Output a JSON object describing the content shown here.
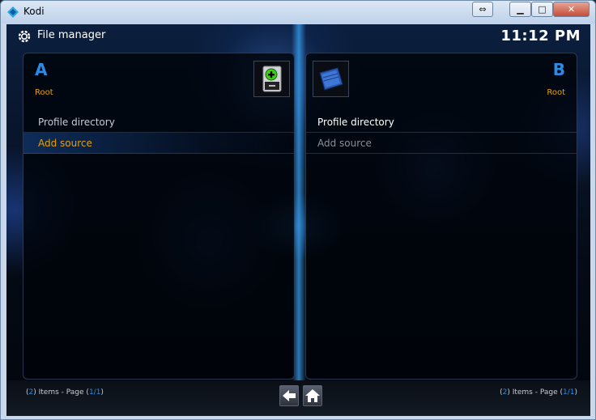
{
  "window": {
    "title": "Kodi",
    "controls": {
      "restore": "⇔",
      "minimize": "▁",
      "maximize": "□",
      "close": "✕"
    }
  },
  "header": {
    "title": "File manager",
    "clock": "11:12 PM",
    "icon": "gear-icon"
  },
  "panels": [
    {
      "letter": "A",
      "path": "Root",
      "thumb_icon": "add-drive-icon",
      "items": [
        {
          "label": "Profile directory",
          "color": "#c8ccd2"
        },
        {
          "label": "Add source",
          "color": "#e8a000",
          "selected": true
        }
      ],
      "footer": {
        "count": "2",
        "items_text": " Items - Page ",
        "page": "1/1"
      }
    },
    {
      "letter": "B",
      "path": "Root",
      "thumb_icon": "folder-icon",
      "items": [
        {
          "label": "Profile directory",
          "color": "#ffffff"
        },
        {
          "label": "Add source",
          "color": "#8a8f98"
        }
      ],
      "footer": {
        "count": "2",
        "items_text": " Items - Page ",
        "page": "1/1"
      }
    }
  ],
  "nav": {
    "back_icon": "back-arrow-icon",
    "home_icon": "home-icon"
  },
  "colors": {
    "accent": "#2b8be6",
    "highlight": "#e8a000"
  }
}
